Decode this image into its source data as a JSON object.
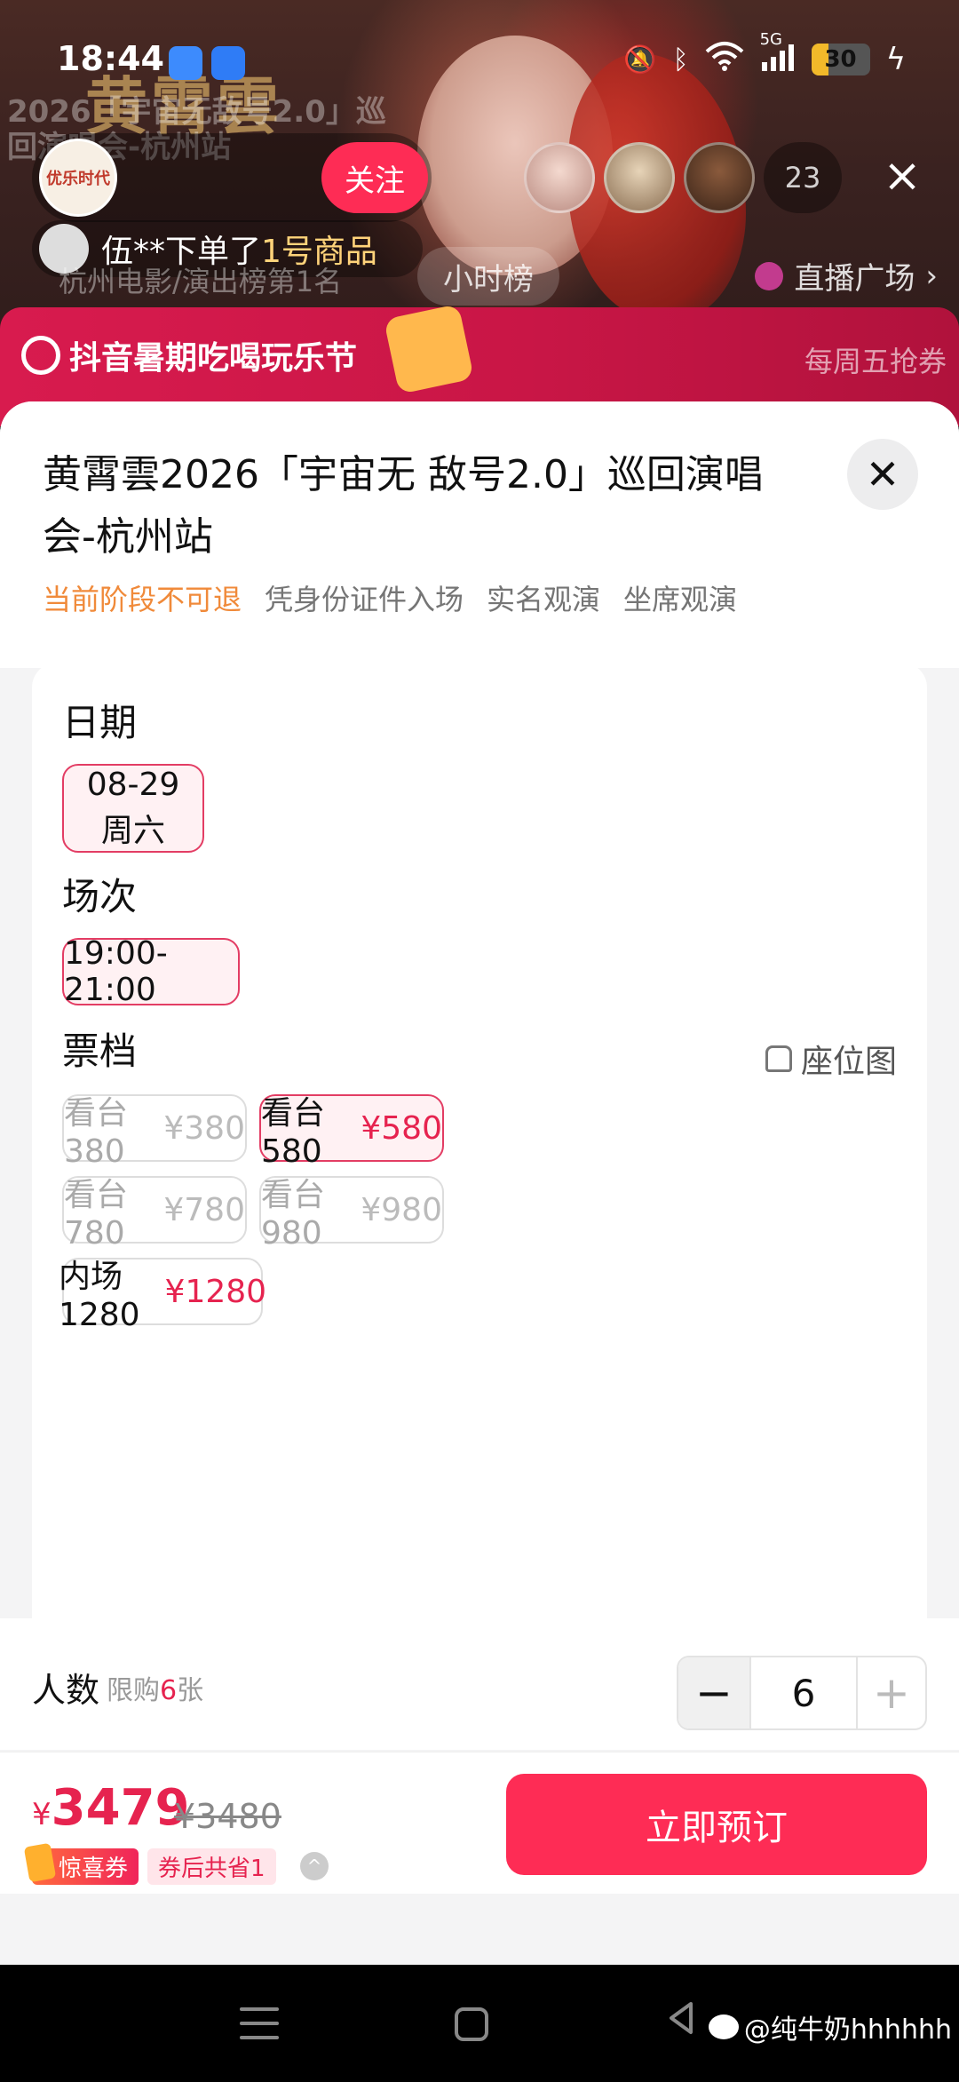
{
  "status_bar": {
    "time": "18:44",
    "network": "5G",
    "battery_level": "30",
    "icons": [
      "weather-app-icon",
      "cloud-app-icon",
      "mute-icon",
      "bluetooth-icon",
      "wifi-icon",
      "signal-icon",
      "battery-icon",
      "charging-icon"
    ]
  },
  "live": {
    "poster_title": "黄霄雲",
    "poster_subtitle": "2026「宇宙无敌号2.0」巡回演唱会-杭州站",
    "anchor_name": "优乐时代",
    "follow_label": "关注",
    "viewer_count": "23",
    "order_toast": {
      "prefix": "伍**下单了",
      "highlight": "1号商品"
    },
    "rank_chip": "小时榜",
    "rank_text": "杭州电影/演出榜第1名",
    "plaza_label": "直播广场"
  },
  "banner": {
    "title": "抖音暑期吃喝玩乐节",
    "right_text": "每周五抢券"
  },
  "sheet": {
    "title": "黄霄雲2026「宇宙无 敌号2.0」巡回演唱会-杭州站",
    "tags": [
      {
        "text": "当前阶段不可退",
        "warn": true
      },
      {
        "text": "凭身份证件入场",
        "warn": false
      },
      {
        "text": "实名观演",
        "warn": false
      },
      {
        "text": "坐席观演",
        "warn": false
      }
    ],
    "date_section": {
      "label": "日期",
      "options": [
        {
          "date": "08-29",
          "weekday": "周六",
          "selected": true
        }
      ]
    },
    "session_section": {
      "label": "场次",
      "options": [
        {
          "time": "19:00-21:00",
          "selected": true
        }
      ]
    },
    "tier_section": {
      "label": "票档",
      "seat_map_label": "座位图",
      "options": [
        {
          "name": "看台380",
          "price": "¥380",
          "state": "soldout"
        },
        {
          "name": "看台580",
          "price": "¥580",
          "state": "selected"
        },
        {
          "name": "看台780",
          "price": "¥780",
          "state": "soldout"
        },
        {
          "name": "看台980",
          "price": "¥980",
          "state": "soldout"
        },
        {
          "name": "内场1280",
          "price": "¥1280",
          "state": "available"
        }
      ]
    },
    "quantity": {
      "label": "人数",
      "limit_prefix": "限购",
      "limit_value": "6",
      "limit_suffix": "张",
      "value": "6",
      "minus": "−",
      "plus": "+"
    },
    "footer": {
      "currency": "¥",
      "price": "3479",
      "original_price": "¥3480",
      "coupon_tag": "惊喜券",
      "coupon_save": "券后共省1",
      "book_label": "立即预订"
    }
  },
  "watermark": "@纯牛奶hhhhhh",
  "colors": {
    "accent": "#fe2c55",
    "price": "#e6234f",
    "warn": "#f08a3a",
    "selected_bg": "#fff1f3",
    "banner": "#d81b4e"
  }
}
